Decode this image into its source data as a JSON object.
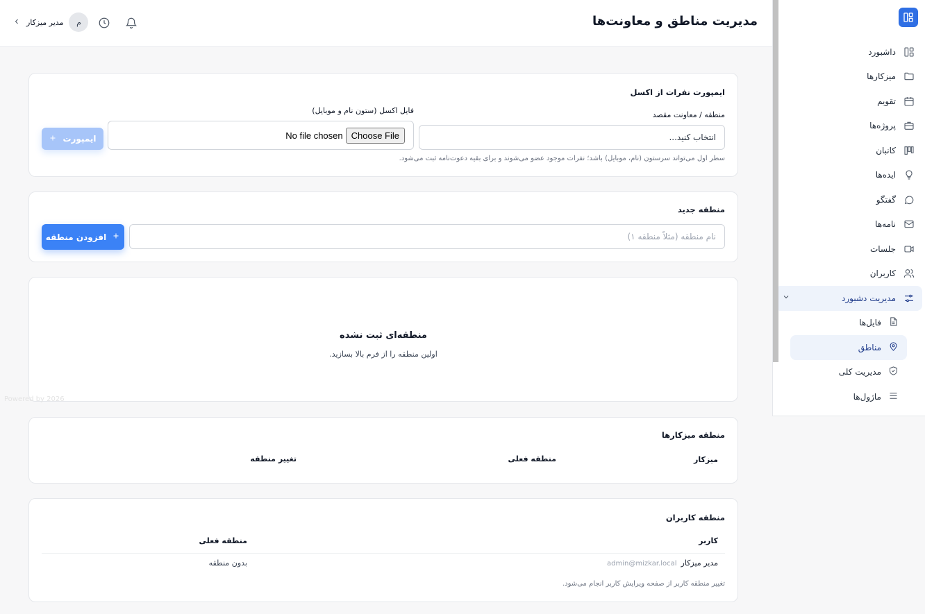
{
  "header": {
    "title": "مدیریت مناطق و معاونت‌ها",
    "user_name": "مدیر میزکار",
    "avatar_initial": "م"
  },
  "sidebar": {
    "items": [
      {
        "label": "داشبورد",
        "icon": "layout-icon"
      },
      {
        "label": "میزکارها",
        "icon": "folder-icon"
      },
      {
        "label": "تقویم",
        "icon": "calendar-icon"
      },
      {
        "label": "پروژه‌ها",
        "icon": "briefcase-icon"
      },
      {
        "label": "کانبان",
        "icon": "kanban-icon"
      },
      {
        "label": "ایده‌ها",
        "icon": "lightbulb-icon"
      },
      {
        "label": "گفتگو",
        "icon": "chat-icon"
      },
      {
        "label": "نامه‌ها",
        "icon": "mail-icon"
      },
      {
        "label": "جلسات",
        "icon": "video-icon"
      },
      {
        "label": "کاربران",
        "icon": "users-icon"
      },
      {
        "label": "مدیریت دشبورد",
        "icon": "sliders-icon"
      }
    ],
    "sub_items": [
      {
        "label": "فایل‌ها",
        "icon": "file-icon"
      },
      {
        "label": "مناطق",
        "icon": "map-pin-icon"
      },
      {
        "label": "مدیریت کلی",
        "icon": "shield-icon"
      },
      {
        "label": "ماژول‌ها",
        "icon": "menu-icon"
      }
    ]
  },
  "import_card": {
    "title": "ایمپورت نفرات از اکسل",
    "region_label": "منطقه / معاونت مقصد",
    "region_select_value": "انتخاب کنید...",
    "file_label": "فایل اکسل (ستون نام و موبایل)",
    "file_button": "Choose File",
    "file_status": "No file chosen",
    "import_button": "ایمپورت",
    "hint": "سطر اول می‌تواند سرستون (نام، موبایل) باشد؛ نفرات موجود عضو می‌شوند و برای بقیه دعوت‌نامه ثبت می‌شود."
  },
  "new_region_card": {
    "title": "منطقه جدید",
    "input_placeholder": "نام منطقه (مثلاً منطقه ۱)",
    "add_button": "افزودن منطقه"
  },
  "empty_state": {
    "title": "منطقه‌ای ثبت نشده",
    "subtitle": "اولین منطقه را از فرم بالا بسازید."
  },
  "powered_by": "Powered by 2026",
  "workspace_region_card": {
    "title": "منطقه میزکارها",
    "columns": [
      "میزکار",
      "منطقه فعلی",
      "تغییر منطقه"
    ]
  },
  "user_region_card": {
    "title": "منطقه کاربران",
    "columns": [
      "کاربر",
      "منطقه فعلی"
    ],
    "rows": [
      {
        "name": "مدیر میزکار",
        "email": "admin@mizkar.local",
        "region": "بدون منطقه"
      }
    ],
    "hint": "تغییر منطقه کاربر از صفحه ویرایش کاربر انجام می‌شود."
  },
  "colors": {
    "accent": "#3b82f6",
    "brand": "#2f6fe4",
    "active_bg": "#eef3fb"
  }
}
